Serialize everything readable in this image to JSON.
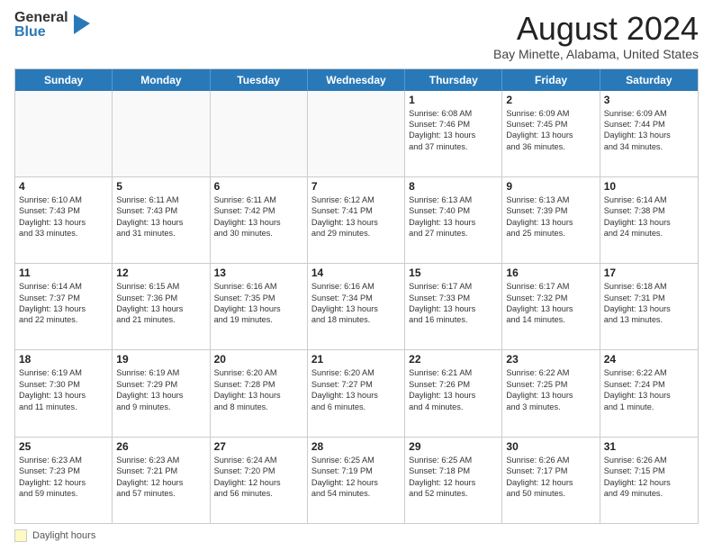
{
  "logo": {
    "general": "General",
    "blue": "Blue"
  },
  "title": "August 2024",
  "location": "Bay Minette, Alabama, United States",
  "headers": [
    "Sunday",
    "Monday",
    "Tuesday",
    "Wednesday",
    "Thursday",
    "Friday",
    "Saturday"
  ],
  "footer_label": "Daylight hours",
  "rows": [
    [
      {
        "day": "",
        "lines": [],
        "empty": true
      },
      {
        "day": "",
        "lines": [],
        "empty": true
      },
      {
        "day": "",
        "lines": [],
        "empty": true
      },
      {
        "day": "",
        "lines": [],
        "empty": true
      },
      {
        "day": "1",
        "lines": [
          "Sunrise: 6:08 AM",
          "Sunset: 7:46 PM",
          "Daylight: 13 hours",
          "and 37 minutes."
        ]
      },
      {
        "day": "2",
        "lines": [
          "Sunrise: 6:09 AM",
          "Sunset: 7:45 PM",
          "Daylight: 13 hours",
          "and 36 minutes."
        ]
      },
      {
        "day": "3",
        "lines": [
          "Sunrise: 6:09 AM",
          "Sunset: 7:44 PM",
          "Daylight: 13 hours",
          "and 34 minutes."
        ]
      }
    ],
    [
      {
        "day": "4",
        "lines": [
          "Sunrise: 6:10 AM",
          "Sunset: 7:43 PM",
          "Daylight: 13 hours",
          "and 33 minutes."
        ]
      },
      {
        "day": "5",
        "lines": [
          "Sunrise: 6:11 AM",
          "Sunset: 7:43 PM",
          "Daylight: 13 hours",
          "and 31 minutes."
        ]
      },
      {
        "day": "6",
        "lines": [
          "Sunrise: 6:11 AM",
          "Sunset: 7:42 PM",
          "Daylight: 13 hours",
          "and 30 minutes."
        ]
      },
      {
        "day": "7",
        "lines": [
          "Sunrise: 6:12 AM",
          "Sunset: 7:41 PM",
          "Daylight: 13 hours",
          "and 29 minutes."
        ]
      },
      {
        "day": "8",
        "lines": [
          "Sunrise: 6:13 AM",
          "Sunset: 7:40 PM",
          "Daylight: 13 hours",
          "and 27 minutes."
        ]
      },
      {
        "day": "9",
        "lines": [
          "Sunrise: 6:13 AM",
          "Sunset: 7:39 PM",
          "Daylight: 13 hours",
          "and 25 minutes."
        ]
      },
      {
        "day": "10",
        "lines": [
          "Sunrise: 6:14 AM",
          "Sunset: 7:38 PM",
          "Daylight: 13 hours",
          "and 24 minutes."
        ]
      }
    ],
    [
      {
        "day": "11",
        "lines": [
          "Sunrise: 6:14 AM",
          "Sunset: 7:37 PM",
          "Daylight: 13 hours",
          "and 22 minutes."
        ]
      },
      {
        "day": "12",
        "lines": [
          "Sunrise: 6:15 AM",
          "Sunset: 7:36 PM",
          "Daylight: 13 hours",
          "and 21 minutes."
        ]
      },
      {
        "day": "13",
        "lines": [
          "Sunrise: 6:16 AM",
          "Sunset: 7:35 PM",
          "Daylight: 13 hours",
          "and 19 minutes."
        ]
      },
      {
        "day": "14",
        "lines": [
          "Sunrise: 6:16 AM",
          "Sunset: 7:34 PM",
          "Daylight: 13 hours",
          "and 18 minutes."
        ]
      },
      {
        "day": "15",
        "lines": [
          "Sunrise: 6:17 AM",
          "Sunset: 7:33 PM",
          "Daylight: 13 hours",
          "and 16 minutes."
        ]
      },
      {
        "day": "16",
        "lines": [
          "Sunrise: 6:17 AM",
          "Sunset: 7:32 PM",
          "Daylight: 13 hours",
          "and 14 minutes."
        ]
      },
      {
        "day": "17",
        "lines": [
          "Sunrise: 6:18 AM",
          "Sunset: 7:31 PM",
          "Daylight: 13 hours",
          "and 13 minutes."
        ]
      }
    ],
    [
      {
        "day": "18",
        "lines": [
          "Sunrise: 6:19 AM",
          "Sunset: 7:30 PM",
          "Daylight: 13 hours",
          "and 11 minutes."
        ]
      },
      {
        "day": "19",
        "lines": [
          "Sunrise: 6:19 AM",
          "Sunset: 7:29 PM",
          "Daylight: 13 hours",
          "and 9 minutes."
        ]
      },
      {
        "day": "20",
        "lines": [
          "Sunrise: 6:20 AM",
          "Sunset: 7:28 PM",
          "Daylight: 13 hours",
          "and 8 minutes."
        ]
      },
      {
        "day": "21",
        "lines": [
          "Sunrise: 6:20 AM",
          "Sunset: 7:27 PM",
          "Daylight: 13 hours",
          "and 6 minutes."
        ]
      },
      {
        "day": "22",
        "lines": [
          "Sunrise: 6:21 AM",
          "Sunset: 7:26 PM",
          "Daylight: 13 hours",
          "and 4 minutes."
        ]
      },
      {
        "day": "23",
        "lines": [
          "Sunrise: 6:22 AM",
          "Sunset: 7:25 PM",
          "Daylight: 13 hours",
          "and 3 minutes."
        ]
      },
      {
        "day": "24",
        "lines": [
          "Sunrise: 6:22 AM",
          "Sunset: 7:24 PM",
          "Daylight: 13 hours",
          "and 1 minute."
        ]
      }
    ],
    [
      {
        "day": "25",
        "lines": [
          "Sunrise: 6:23 AM",
          "Sunset: 7:23 PM",
          "Daylight: 12 hours",
          "and 59 minutes."
        ]
      },
      {
        "day": "26",
        "lines": [
          "Sunrise: 6:23 AM",
          "Sunset: 7:21 PM",
          "Daylight: 12 hours",
          "and 57 minutes."
        ]
      },
      {
        "day": "27",
        "lines": [
          "Sunrise: 6:24 AM",
          "Sunset: 7:20 PM",
          "Daylight: 12 hours",
          "and 56 minutes."
        ]
      },
      {
        "day": "28",
        "lines": [
          "Sunrise: 6:25 AM",
          "Sunset: 7:19 PM",
          "Daylight: 12 hours",
          "and 54 minutes."
        ]
      },
      {
        "day": "29",
        "lines": [
          "Sunrise: 6:25 AM",
          "Sunset: 7:18 PM",
          "Daylight: 12 hours",
          "and 52 minutes."
        ]
      },
      {
        "day": "30",
        "lines": [
          "Sunrise: 6:26 AM",
          "Sunset: 7:17 PM",
          "Daylight: 12 hours",
          "and 50 minutes."
        ]
      },
      {
        "day": "31",
        "lines": [
          "Sunrise: 6:26 AM",
          "Sunset: 7:15 PM",
          "Daylight: 12 hours",
          "and 49 minutes."
        ]
      }
    ]
  ]
}
